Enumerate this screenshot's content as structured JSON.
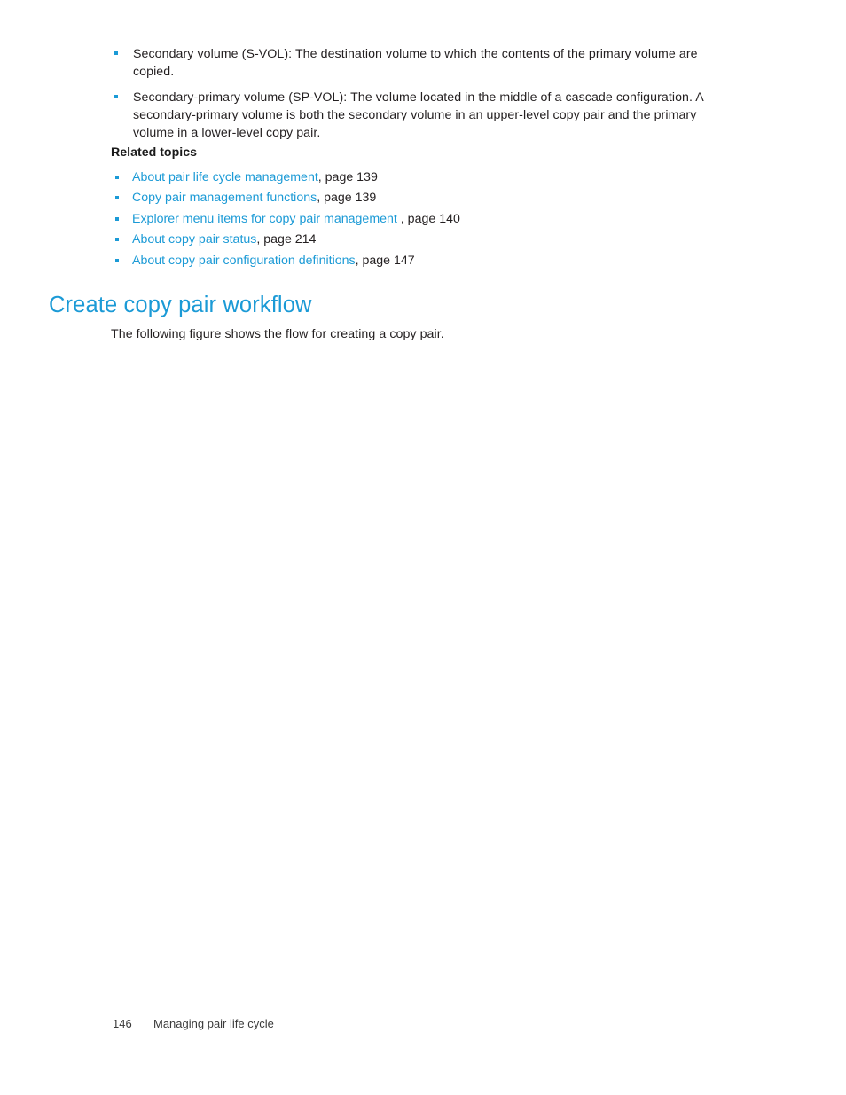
{
  "document": {
    "background_color": "#ffffff",
    "accent_color": "#1b9ad6",
    "text_color": "#231f20"
  },
  "definitions": [
    {
      "bullet": "square-bullet-icon",
      "text": "Secondary volume (S-VOL): The destination volume to which the contents of the primary volume are copied."
    },
    {
      "bullet": "square-bullet-icon",
      "text": "Secondary-primary volume (SP-VOL): The volume located in the middle of a cascade configuration. A secondary-primary volume is both the secondary volume in an upper-level copy pair and the primary volume in a lower-level copy pair."
    }
  ],
  "related_topics": {
    "heading": "Related topics",
    "items": [
      {
        "link": "About pair life cycle management",
        "suffix": ", page 139"
      },
      {
        "link": "Copy pair management functions",
        "suffix": ", page 139"
      },
      {
        "link": "Explorer menu items for copy pair management",
        "suffix": " , page 140"
      },
      {
        "link": "About copy pair status",
        "suffix": ", page 214"
      },
      {
        "link": "About copy pair configuration definitions",
        "suffix": ", page 147"
      }
    ]
  },
  "section": {
    "heading": "Create copy pair workflow",
    "paragraph": "The following figure shows the flow for creating a copy pair."
  },
  "footer": {
    "page_number": "146",
    "chapter_title": "Managing pair life cycle"
  }
}
